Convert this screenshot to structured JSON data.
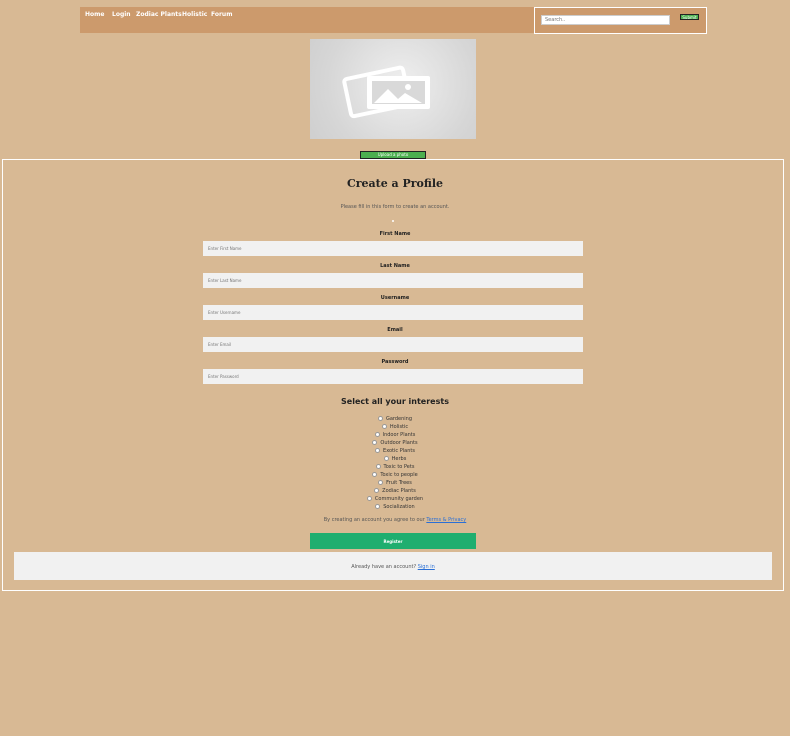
{
  "nav": {
    "links": [
      "Home",
      "Login",
      "Zodiac Plants",
      "Holistic",
      "Forum"
    ]
  },
  "search": {
    "placeholder": "Search..",
    "button": "Submit"
  },
  "upload": {
    "button": "Upload a photo"
  },
  "form": {
    "title": "Create a Profile",
    "subtitle": "Please fill in this form to create an account.",
    "fields": [
      {
        "label": "First Name",
        "placeholder": "Enter First Name"
      },
      {
        "label": "Last Name",
        "placeholder": "Enter Last Name"
      },
      {
        "label": "Username",
        "placeholder": "Enter Username"
      },
      {
        "label": "Email",
        "placeholder": "Enter Email"
      },
      {
        "label": "Password",
        "placeholder": "Enter Password"
      }
    ],
    "interests_title": "Select all your interests",
    "interests": [
      "Gardening",
      "Holistic",
      "Indoor Plants",
      "Outdoor Plants",
      "Exotic Plants",
      "Herbs",
      "Toxic to Pets",
      "Toxic to people",
      "Fruit Trees",
      "Zodiac Plants",
      "Community garden",
      "Socialization"
    ],
    "terms_text": "By creating an account you agree to our",
    "terms_link": "Terms & Privacy",
    "register": "Register",
    "signin_text": "Already have an account?",
    "signin_link": "Sign in"
  }
}
